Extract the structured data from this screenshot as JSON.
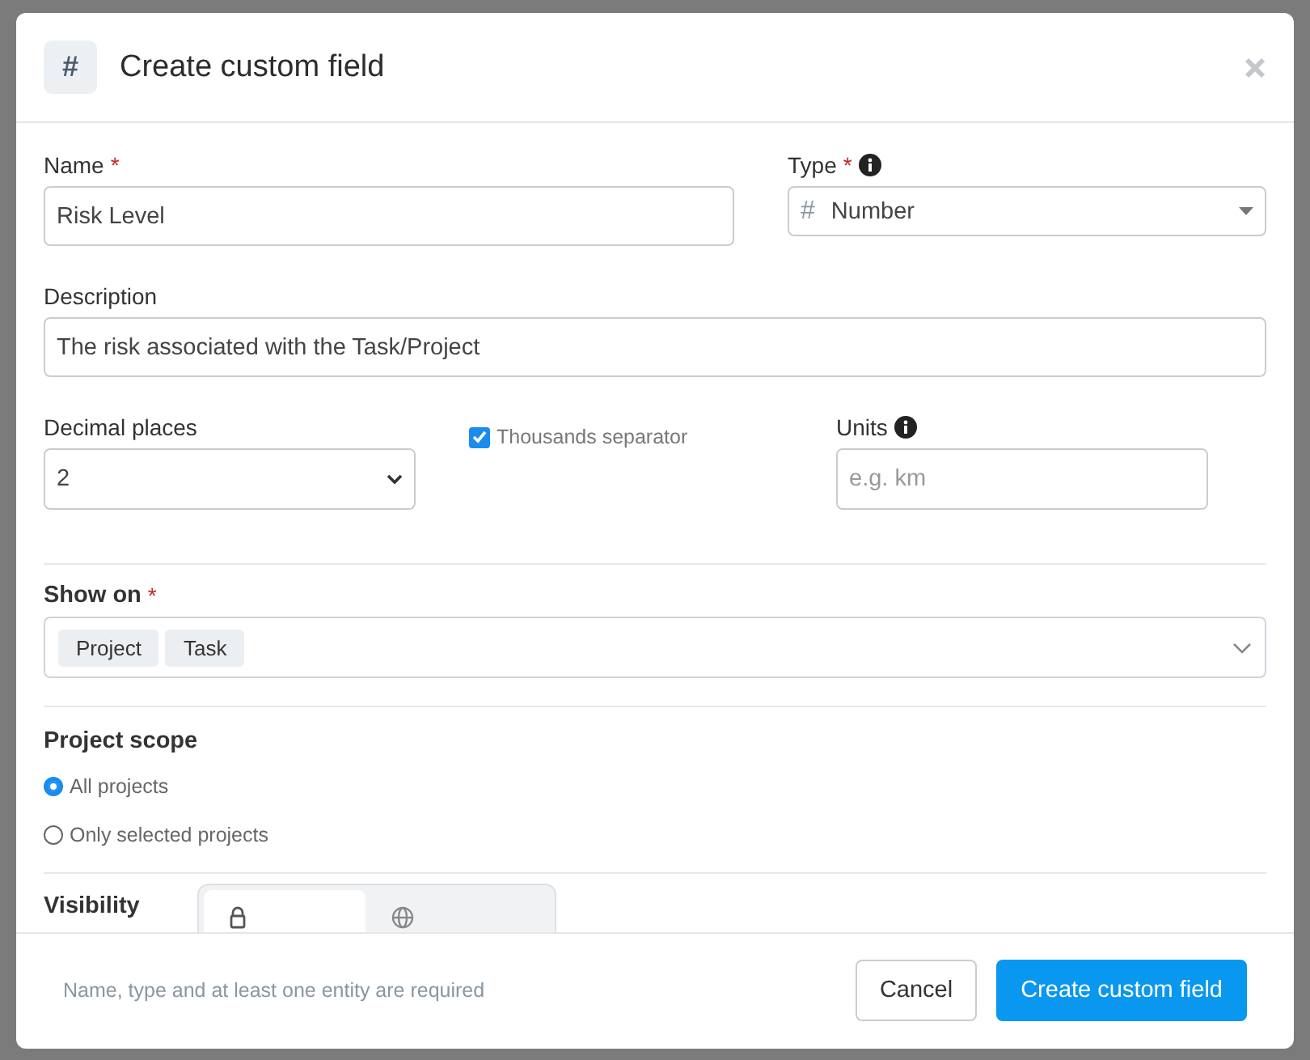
{
  "dialog": {
    "header_icon": "#",
    "title": "Create custom field",
    "name": {
      "label": "Name",
      "required_mark": "*",
      "value": "Risk Level"
    },
    "type": {
      "label": "Type",
      "required_mark": "*",
      "glyph": "#",
      "value": "Number"
    },
    "description": {
      "label": "Description",
      "value": "The risk associated with the Task/Project"
    },
    "decimal_places": {
      "label": "Decimal places",
      "value": "2"
    },
    "thousands_separator": {
      "label": "Thousands separator",
      "checked": true
    },
    "units": {
      "label": "Units",
      "placeholder": "e.g. km"
    },
    "show_on": {
      "label": "Show on",
      "required_mark": "*",
      "tags": [
        "Project",
        "Task"
      ]
    },
    "project_scope": {
      "label": "Project scope",
      "options": [
        {
          "label": "All projects",
          "selected": true
        },
        {
          "label": "Only selected projects",
          "selected": false
        }
      ]
    },
    "visibility": {
      "label": "Visibility",
      "options": [
        {
          "kind": "lock",
          "selected": true
        },
        {
          "kind": "globe",
          "selected": false
        }
      ]
    },
    "footer": {
      "hint": "Name, type and at least one entity are required",
      "buttons": [
        {
          "kind": "secondary",
          "label": "Cancel"
        },
        {
          "kind": "primary",
          "label": "Create custom field"
        }
      ]
    }
  }
}
